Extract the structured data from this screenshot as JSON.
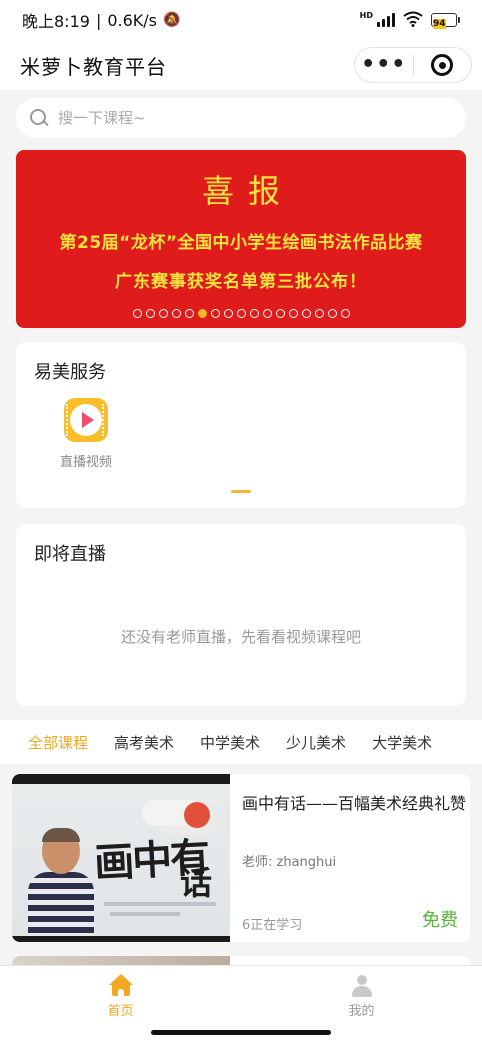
{
  "status_bar": {
    "time": "晚上8:19",
    "separator": "|",
    "speed": "0.6K/s",
    "network_label": "HD",
    "battery": "94"
  },
  "nav": {
    "title": "米萝卜教育平台",
    "more": "•••"
  },
  "search": {
    "placeholder": "搜一下课程~"
  },
  "banner": {
    "title": "喜报",
    "line1": "第25届“龙杯”全国中小学生绘画书法作品比赛",
    "line2": "广东赛事获奖名单第三批公布！",
    "dot_count": 17,
    "active_dot": 5,
    "colors": {
      "background": "#df1b1b",
      "text": "#f7e33e",
      "active_dot": "#f5b62a"
    }
  },
  "services": {
    "title": "易美服务",
    "items": [
      {
        "label": "直播视频",
        "icon": "live-video-icon"
      }
    ]
  },
  "live": {
    "title": "即将直播",
    "empty_text": "还没有老师直播，先看看视频课程吧"
  },
  "categories": {
    "tabs": [
      "全部课程",
      "高考美术",
      "中学美术",
      "少儿美术",
      "大学美术"
    ],
    "active_index": 0,
    "active_color": "#f2a91e"
  },
  "courses": [
    {
      "title": "画中有话——百幅美术经典礼赞",
      "thumb_text_1": "画中有",
      "thumb_text_2": "话",
      "teacher": "老师: zhanghui",
      "learners": "6正在学习",
      "price": "免费",
      "price_color": "#58b43a"
    }
  ],
  "tab_bar": {
    "items": [
      {
        "label": "首页",
        "icon": "home-icon",
        "active": true
      },
      {
        "label": "我的",
        "icon": "user-icon",
        "active": false
      }
    ],
    "active_color": "#f3a824"
  }
}
